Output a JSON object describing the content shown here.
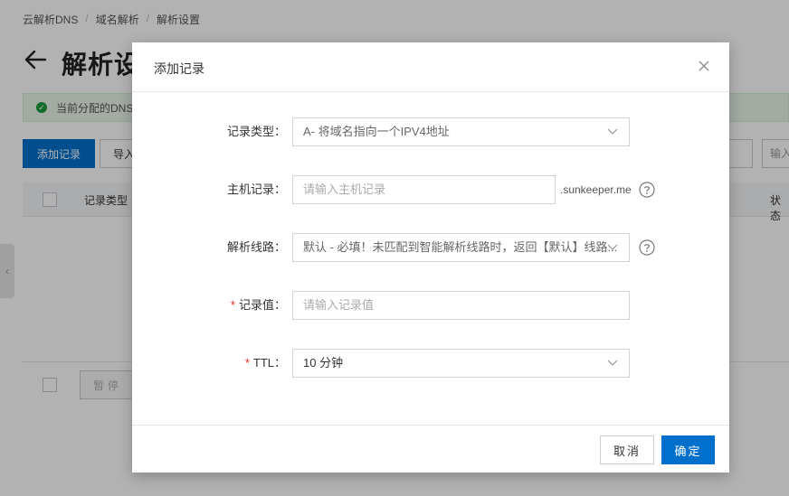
{
  "breadcrumb": [
    "云解析DNS",
    "域名解析",
    "解析设置"
  ],
  "breadcrumb_sep": "/",
  "page": {
    "title": "解析设",
    "notice": "当前分配的DNS",
    "add_button": "添加记录",
    "import_button": "导入",
    "right_input": "输入",
    "th_type": "记录类型",
    "th_status": "状态",
    "side_tab": "‹",
    "pause_button": "暂停"
  },
  "dialog": {
    "title": "添加记录",
    "fields": {
      "record_type": {
        "label": "记录类型：",
        "value": "A- 将域名指向一个IPV4地址"
      },
      "host": {
        "label": "主机记录：",
        "placeholder": "请输入主机记录",
        "suffix": ".sunkeeper.me"
      },
      "line": {
        "label": "解析线路：",
        "value": "默认 - 必填！未匹配到智能解析线路时，返回【默认】线路..."
      },
      "record_value": {
        "required": "*",
        "label": "记录值：",
        "placeholder": "请输入记录值"
      },
      "ttl": {
        "required": "*",
        "label": "TTL：",
        "value": "10 分钟"
      }
    },
    "cancel_label": "取消",
    "ok_label": "确定"
  },
  "colors": {
    "primary": "#0070cc",
    "required": "#e72b2b",
    "success": "#1c9a3b"
  }
}
